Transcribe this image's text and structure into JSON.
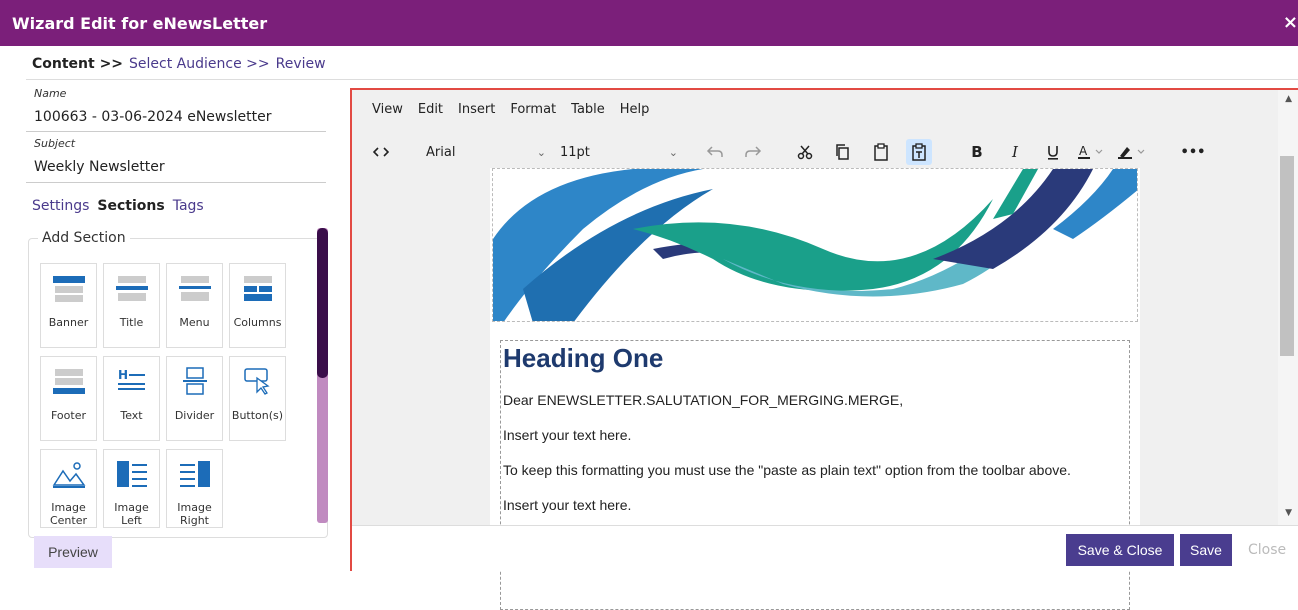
{
  "dialog": {
    "title": "Wizard Edit for eNewsLetter",
    "close_glyph": "×"
  },
  "steps": {
    "content": "Content >>",
    "audience": "Select Audience >>",
    "review": "Review"
  },
  "form": {
    "name_label": "Name",
    "name_value": "100663 - 03-06-2024 eNewsletter",
    "subject_label": "Subject",
    "subject_value": "Weekly Newsletter"
  },
  "subtabs": {
    "settings": "Settings",
    "sections": "Sections",
    "tags": "Tags"
  },
  "add_section": {
    "legend": "Add Section",
    "tiles": [
      {
        "label": "Banner",
        "icon": "banner-icon"
      },
      {
        "label": "Title",
        "icon": "title-icon"
      },
      {
        "label": "Menu",
        "icon": "menu-icon"
      },
      {
        "label": "Columns",
        "icon": "columns-icon"
      },
      {
        "label": "Footer",
        "icon": "footer-icon"
      },
      {
        "label": "Text",
        "icon": "text-icon"
      },
      {
        "label": "Divider",
        "icon": "divider-icon"
      },
      {
        "label": "Button(s)",
        "icon": "button-icon"
      },
      {
        "label": "Image Center",
        "icon": "image-center-icon"
      },
      {
        "label": "Image Left",
        "icon": "image-left-icon"
      },
      {
        "label": "Image Right",
        "icon": "image-right-icon"
      }
    ]
  },
  "preview_label": "Preview",
  "editor": {
    "menu": [
      "View",
      "Edit",
      "Insert",
      "Format",
      "Table",
      "Help"
    ],
    "font": "Arial",
    "size": "11pt",
    "toolbar_icons": [
      "code-icon",
      "undo-icon",
      "redo-icon",
      "cut-icon",
      "copy-icon",
      "paste-icon",
      "paste-text-icon",
      "bold-icon",
      "italic-icon",
      "underline-icon",
      "text-color-icon",
      "highlight-icon",
      "more-icon"
    ]
  },
  "document": {
    "heading": "Heading One",
    "salutation": "Dear ENEWSLETTER.SALUTATION_FOR_MERGING.MERGE,",
    "para1": "Insert your text here.",
    "para2": "To keep this formatting you must use the \"paste as plain text\" option from the toolbar above.",
    "para3": "Insert your text here."
  },
  "footer": {
    "save_close": "Save & Close",
    "save": "Save",
    "close": "Close"
  },
  "colors": {
    "brand": "#7b1f7a",
    "primary_button": "#4a3d8f",
    "heading": "#1e3a6e",
    "accent_border": "#e24a43"
  }
}
